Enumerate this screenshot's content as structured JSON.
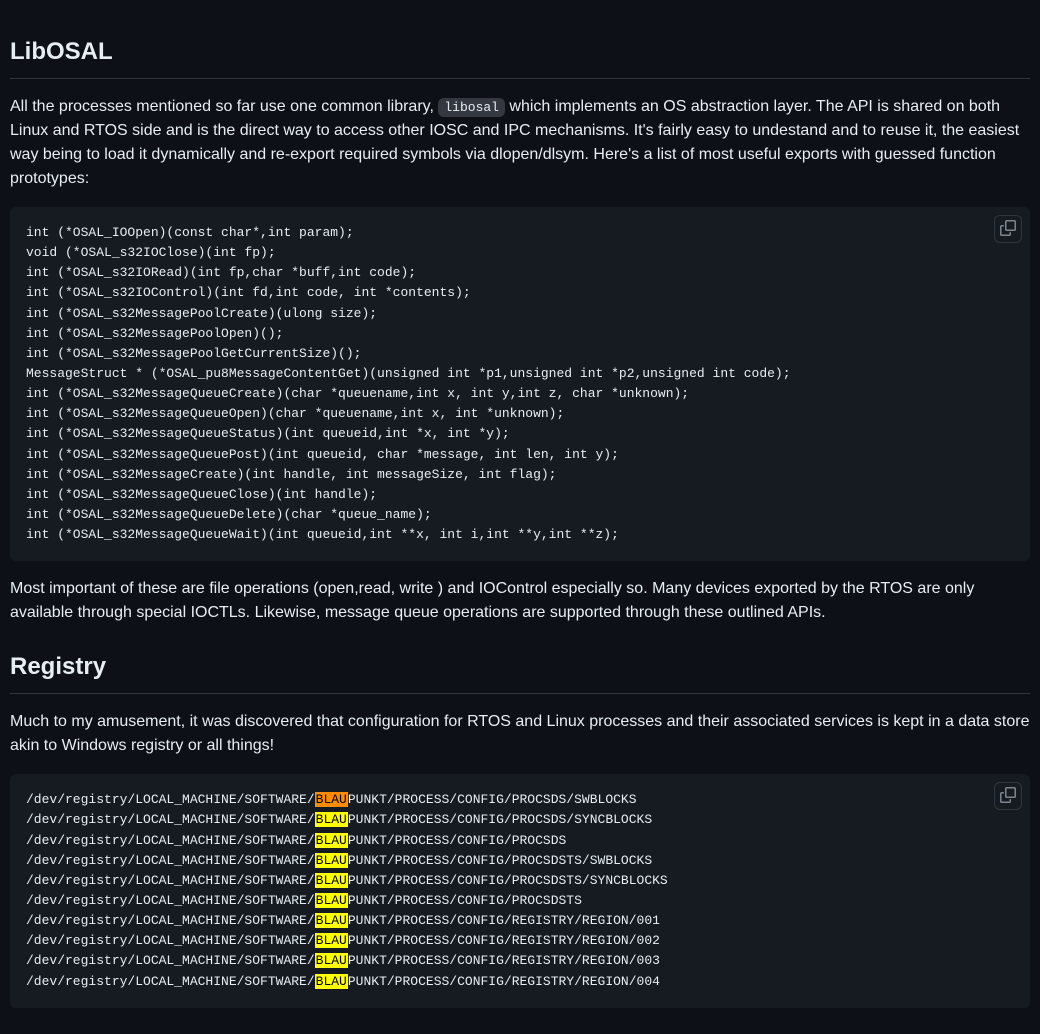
{
  "section1": {
    "heading": "LibOSAL",
    "para1_pre": "All the processes mentioned so far use one common library, ",
    "para1_code": "libosal",
    "para1_post": " which implements an OS abstraction layer. The API is shared on both Linux and RTOS side and is the direct way to access other IOSC and IPC mechanisms. It's fairly easy to undestand and to reuse it, the easiest way being to load it dynamically and re-export required symbols via dlopen/dlsym. Here's a list of most useful exports with guessed function prototypes:",
    "code": "int (*OSAL_IOOpen)(const char*,int param);\nvoid (*OSAL_s32IOClose)(int fp);\nint (*OSAL_s32IORead)(int fp,char *buff,int code);\nint (*OSAL_s32IOControl)(int fd,int code, int *contents);\nint (*OSAL_s32MessagePoolCreate)(ulong size);\nint (*OSAL_s32MessagePoolOpen)();\nint (*OSAL_s32MessagePoolGetCurrentSize)();\nMessageStruct * (*OSAL_pu8MessageContentGet)(unsigned int *p1,unsigned int *p2,unsigned int code);\nint (*OSAL_s32MessageQueueCreate)(char *queuename,int x, int y,int z, char *unknown);\nint (*OSAL_s32MessageQueueOpen)(char *queuename,int x, int *unknown);\nint (*OSAL_s32MessageQueueStatus)(int queueid,int *x, int *y);\nint (*OSAL_s32MessageQueuePost)(int queueid, char *message, int len, int y);\nint (*OSAL_s32MessageCreate)(int handle, int messageSize, int flag);\nint (*OSAL_s32MessageQueueClose)(int handle);\nint (*OSAL_s32MessageQueueDelete)(char *queue_name);\nint (*OSAL_s32MessageQueueWait)(int queueid,int **x, int i,int **y,int **z);",
    "para2": "Most important of these are file operations (open,read, write ) and IOControl especially so. Many devices exported by the RTOS are only available through special IOCTLs. Likewise, message queue operations are supported through these outlined APIs."
  },
  "section2": {
    "heading": "Registry",
    "para1": "Much to my amusement, it was discovered that configuration for RTOS and Linux processes and their associated services is kept in a data store akin to Windows registry or all things!",
    "registry": {
      "prefix": "/dev/registry/LOCAL_MACHINE/SOFTWARE/",
      "highlight": "BLAU",
      "lines": [
        "PUNKT/PROCESS/CONFIG/PROCSDS/SWBLOCKS",
        "PUNKT/PROCESS/CONFIG/PROCSDS/SYNCBLOCKS",
        "PUNKT/PROCESS/CONFIG/PROCSDS",
        "PUNKT/PROCESS/CONFIG/PROCSDSTS/SWBLOCKS",
        "PUNKT/PROCESS/CONFIG/PROCSDSTS/SYNCBLOCKS",
        "PUNKT/PROCESS/CONFIG/PROCSDSTS",
        "PUNKT/PROCESS/CONFIG/REGISTRY/REGION/001",
        "PUNKT/PROCESS/CONFIG/REGISTRY/REGION/002",
        "PUNKT/PROCESS/CONFIG/REGISTRY/REGION/003",
        "PUNKT/PROCESS/CONFIG/REGISTRY/REGION/004"
      ]
    }
  }
}
